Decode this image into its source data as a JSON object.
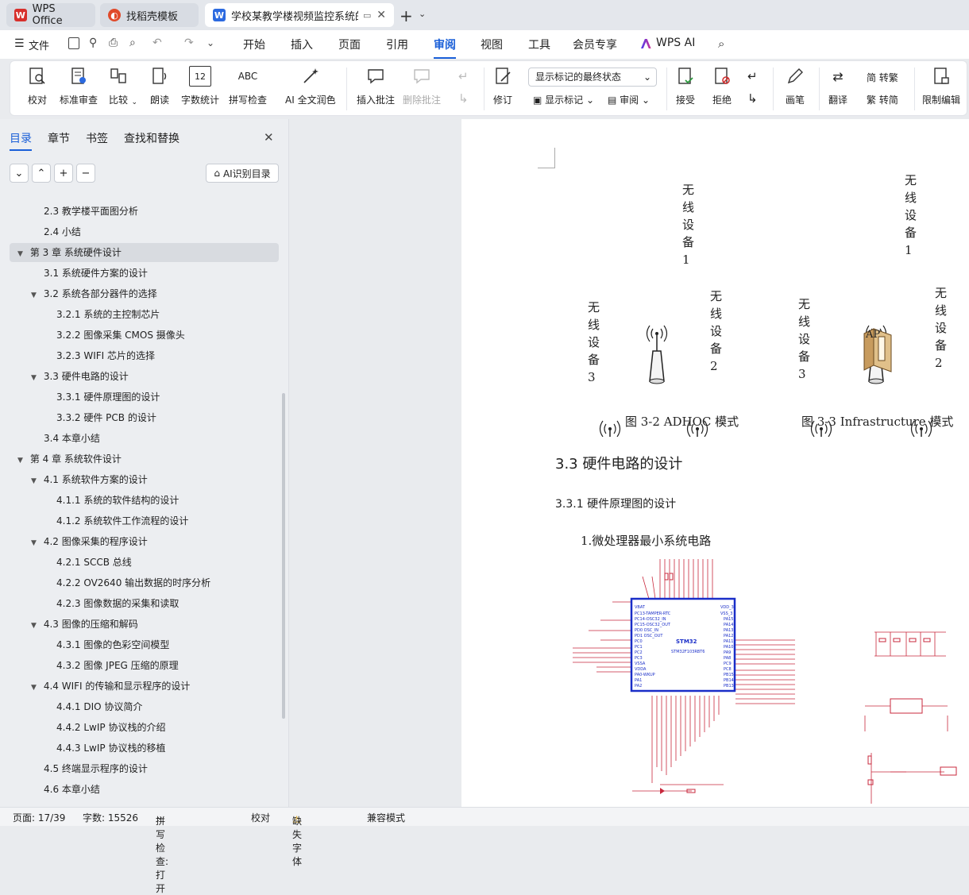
{
  "tabs": [
    {
      "label": "WPS Office"
    },
    {
      "label": "找稻壳模板"
    },
    {
      "label": "学校某教学楼视频监控系统的"
    }
  ],
  "menu": {
    "file": "文件",
    "items": [
      "开始",
      "插入",
      "页面",
      "引用",
      "审阅",
      "视图",
      "工具",
      "会员专享",
      "WPS AI"
    ]
  },
  "ribbon": {
    "proofread": "校对",
    "std_review": "标准审查",
    "compare": "比较",
    "read_aloud": "朗读",
    "word_count": "字数统计",
    "spell_check": "拼写检查",
    "ai_polish": "AI 全文润色",
    "insert_comment": "插入批注",
    "delete_comment": "删除批注",
    "revise": "修订",
    "markup_select": "显示标记的最终状态",
    "show_markup": "显示标记",
    "review": "审阅",
    "accept": "接受",
    "reject": "拒绝",
    "pen": "画笔",
    "translate": "翻译",
    "to_traditional": "转繁",
    "to_simplified": "转简",
    "restrict_edit": "限制编辑",
    "spell_icon_text": "ABC",
    "count_icon_text": "12"
  },
  "sidebar": {
    "tabs": [
      "目录",
      "章节",
      "书签",
      "查找和替换"
    ],
    "ai_toc": "AI识别目录",
    "toc": [
      {
        "label": "2.3  教学楼平面图分析"
      },
      {
        "label": "2.4  小结"
      },
      {
        "label": "第 3 章  系统硬件设计"
      },
      {
        "label": "3.1 系统硬件方案的设计"
      },
      {
        "label": "3.2 系统各部分器件的选择"
      },
      {
        "label": "3.2.1 系统的主控制芯片"
      },
      {
        "label": "3.2.2 图像采集 CMOS 摄像头"
      },
      {
        "label": "3.2.3 WIFI 芯片的选择"
      },
      {
        "label": "3.3 硬件电路的设计"
      },
      {
        "label": "3.3.1 硬件原理图的设计"
      },
      {
        "label": "3.3.2 硬件 PCB 的设计"
      },
      {
        "label": "3.4 本章小结"
      },
      {
        "label": "第 4 章  系统软件设计"
      },
      {
        "label": "4.1 系统软件方案的设计"
      },
      {
        "label": "4.1.1 系统的软件结构的设计"
      },
      {
        "label": "4.1.2 系统软件工作流程的设计"
      },
      {
        "label": "4.2 图像采集的程序设计"
      },
      {
        "label": "4.2.1 SCCB 总线"
      },
      {
        "label": "4.2.2 OV2640 输出数据的时序分析"
      },
      {
        "label": "4.2.3 图像数据的采集和读取"
      },
      {
        "label": "4.3 图像的压缩和解码"
      },
      {
        "label": "4.3.1 图像的色彩空间模型"
      },
      {
        "label": "4.3.2 图像 JPEG 压缩的原理"
      },
      {
        "label": "4.4 WIFI 的传输和显示程序的设计"
      },
      {
        "label": "4.4.1 DIO 协议简介"
      },
      {
        "label": "4.4.2 LwIP 协议栈的介绍"
      },
      {
        "label": "4.4.3 LwIP 协议栈的移植"
      },
      {
        "label": "4.5 终端显示程序的设计"
      },
      {
        "label": "4.6 本章小结"
      }
    ]
  },
  "document": {
    "device_label_1": "无线设备1",
    "device_label_2": "无线设备2",
    "device_label_3": "无线设备3",
    "ap_label": "AP",
    "caption_left": "图 3-2  ADHOC 模式",
    "caption_right": "图 3-3  Infrastructure 模式",
    "heading_33": "3.3 硬件电路的设计",
    "heading_331": "3.3.1 硬件原理图的设计",
    "item_1": "1.微处理器最小系统电路",
    "chip_name": "STM32",
    "chip_part": "STM32F103RBT6"
  },
  "status": {
    "page": "页面: 17/39",
    "words": "字数: 15526",
    "spell": "拼写检查: 打开",
    "proof": "校对",
    "missing_font": "缺失字体",
    "compat": "兼容模式"
  },
  "colors": {
    "accent": "#1a5fd8",
    "wps_red": "#d7302c",
    "schematic_red": "#c8283c",
    "schematic_blue": "#1a2ec8"
  }
}
